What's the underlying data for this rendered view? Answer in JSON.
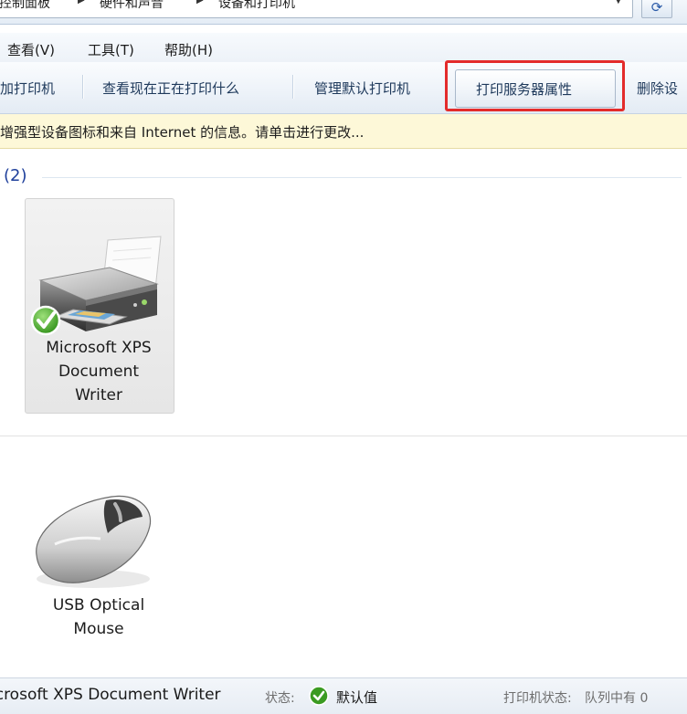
{
  "address_bar": {
    "crumbs": [
      "控制面板",
      "硬件和声音",
      "设备和打印机"
    ]
  },
  "menu": {
    "items": [
      "查看(V)",
      "工具(T)",
      "帮助(H)"
    ]
  },
  "commands": {
    "add_printer": "加打印机",
    "see_printing": "查看现在正在打印什么",
    "manage_default": "管理默认打印机",
    "print_server_props": "打印服务器属性",
    "remove": "删除设"
  },
  "info_bar": {
    "text": "增强型设备图标和来自 Internet 的信息。请单击进行更改..."
  },
  "group": {
    "header": "(2)"
  },
  "devices": [
    {
      "name_line1": "Microsoft XPS",
      "name_line2": "Document",
      "name_line3": "Writer",
      "icon": "printer-icon",
      "default": true
    },
    {
      "name_line1": "USB Optical",
      "name_line2": "Mouse",
      "icon": "mouse-icon"
    }
  ],
  "status": {
    "device_name": "icrosoft XPS Document Writer",
    "state_label": "状态:",
    "state_value": "默认值",
    "printer_status_label": "打印机状态:",
    "printer_status_value": "队列中有 0"
  },
  "colors": {
    "highlight": "#e32b2b",
    "info_bar": "#fdf8d8",
    "group_header": "#1e3f9b"
  }
}
